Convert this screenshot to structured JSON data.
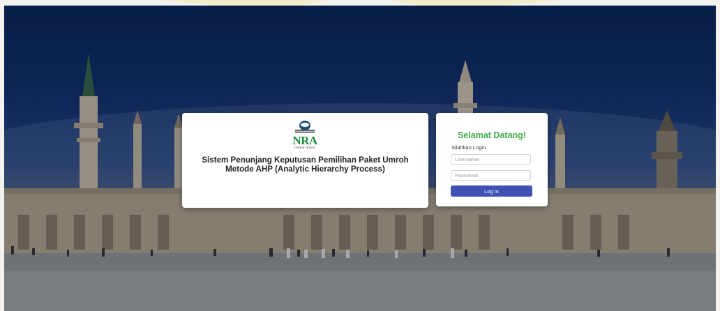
{
  "brand": {
    "logo_text": "NRA",
    "logo_subtext": "TOUR & TRAVEL",
    "logo_top_text": "NUR RAUDHAH ARAFAH",
    "title_line1": "Sistem Penunjang Keputusan Pemilihan Paket Umroh",
    "title_line2": "Metode AHP (Analytic Hierarchy Process)"
  },
  "login": {
    "heading": "Selamat Datang!",
    "hint": "Silahkan Login.",
    "username_placeholder": "Username",
    "password_placeholder": "Password",
    "button_label": "Log In"
  },
  "colors": {
    "heading": "#3fae4a",
    "button": "#3f51b5",
    "logo": "#1f8a3b"
  }
}
